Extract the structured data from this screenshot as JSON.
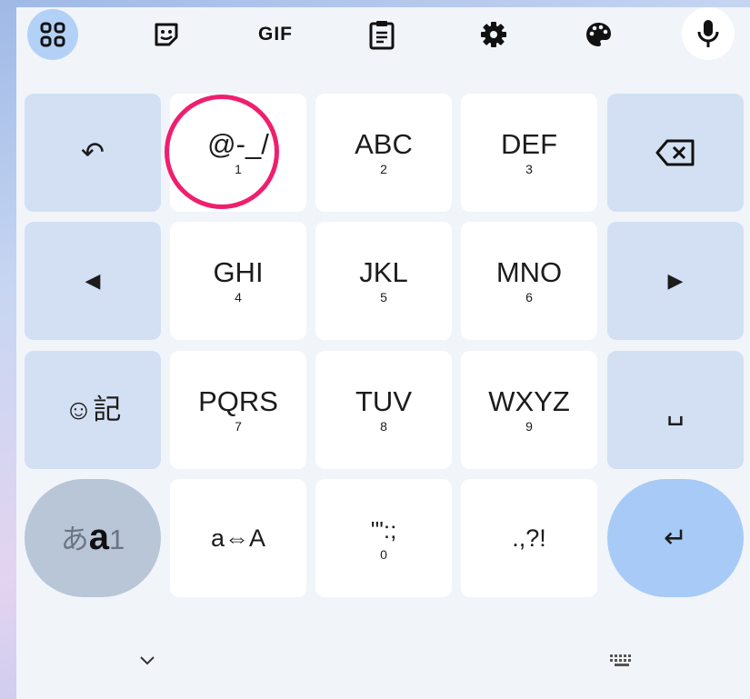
{
  "toolbar": {
    "items": [
      {
        "icon": "apps-grid-icon"
      },
      {
        "icon": "sticker-icon"
      },
      {
        "label": "GIF"
      },
      {
        "icon": "clipboard-icon"
      },
      {
        "icon": "gear-icon"
      },
      {
        "icon": "palette-icon"
      },
      {
        "icon": "microphone-icon"
      }
    ],
    "active_color": "#b3d1f7"
  },
  "keys": {
    "undo": {
      "glyph": "↶"
    },
    "k1": {
      "main": "@-_/",
      "sub": "1"
    },
    "k2": {
      "main": "ABC",
      "sub": "2"
    },
    "k3": {
      "main": "DEF",
      "sub": "3"
    },
    "backspace": {
      "icon": "backspace-icon"
    },
    "left": {
      "glyph": "◀"
    },
    "k4": {
      "main": "GHI",
      "sub": "4"
    },
    "k5": {
      "main": "JKL",
      "sub": "5"
    },
    "k6": {
      "main": "MNO",
      "sub": "6"
    },
    "right": {
      "glyph": "▶"
    },
    "emoji": {
      "main": "☺記"
    },
    "k7": {
      "main": "PQRS",
      "sub": "7"
    },
    "k8": {
      "main": "TUV",
      "sub": "8"
    },
    "k9": {
      "main": "WXYZ",
      "sub": "9"
    },
    "space": {
      "glyph": "␣"
    },
    "mode": {
      "a": "あ",
      "b": "a",
      "c": "1"
    },
    "case": {
      "main": "a⇔A"
    },
    "k0": {
      "main": "'\":;",
      "sub": "0"
    },
    "punct": {
      "main": ".,?!"
    },
    "enter": {
      "glyph": "↵"
    }
  },
  "bottom": {
    "hide_icon": "chevron-down-icon",
    "switch_icon": "keyboard-icon"
  },
  "colors": {
    "fn_key": "#d3e0f3",
    "enter_key": "#a7cbf6",
    "annotation": "#ef1f6e"
  }
}
